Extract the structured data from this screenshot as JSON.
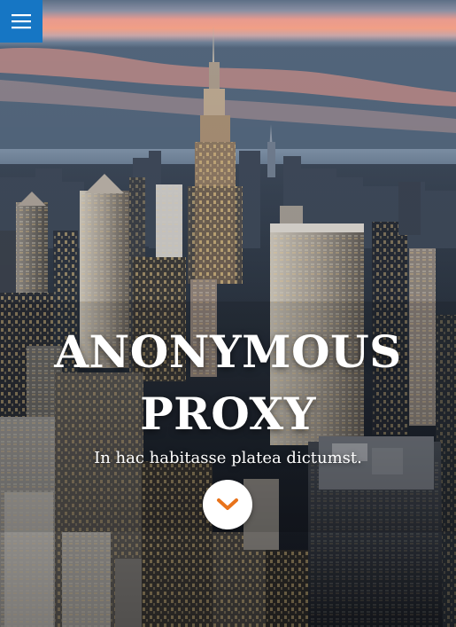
{
  "hero": {
    "title_line1": "ANONYMOUS",
    "title_line2": "PROXY",
    "subtitle": "In hac habitasse platea dictumst."
  },
  "menu": {
    "icon": "hamburger-menu-icon",
    "color": "#1676c4"
  },
  "scroll_button": {
    "icon": "chevron-down-icon",
    "icon_color": "#e8731b"
  },
  "background": {
    "description_tag": "city-skyline-photo"
  }
}
